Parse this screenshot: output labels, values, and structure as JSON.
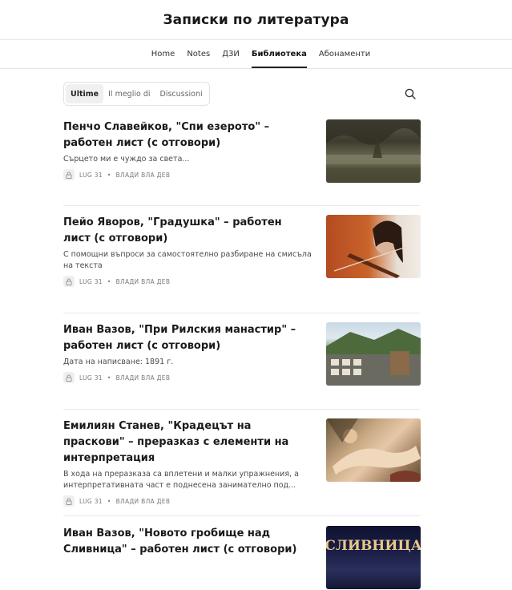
{
  "site": {
    "title": "Записки по литература"
  },
  "nav": {
    "items": [
      {
        "label": "Home"
      },
      {
        "label": "Notes"
      },
      {
        "label": "ДЗИ"
      },
      {
        "label": "Библиотека",
        "active": true
      },
      {
        "label": "Абонаменти"
      }
    ]
  },
  "filters": {
    "tabs": [
      {
        "label": "Ultime",
        "active": true
      },
      {
        "label": "Il meglio di"
      },
      {
        "label": "Discussioni"
      }
    ]
  },
  "posts": [
    {
      "title": "Пенчо Славейков, \"Спи езерото\" – работен лист (с отговори)",
      "subtitle": "Сърцето ми е чуждо за света...",
      "date": "LUG 31",
      "author": "ВЛАДИ ВЛА ДЕВ"
    },
    {
      "title": "Пейо Яворов, \"Градушка\" – работен лист (с отговори)",
      "subtitle": "С помощни въпроси за самостоятелно разбиране на смисъла на текста",
      "date": "LUG 31",
      "author": "ВЛАДИ ВЛА ДЕВ"
    },
    {
      "title": "Иван Вазов, \"При Рилския манастир\" – работен лист (с отговори)",
      "subtitle": "Дата на написване: 1891 г.",
      "date": "LUG 31",
      "author": "ВЛАДИ ВЛА ДЕВ"
    },
    {
      "title": "Емилиян Станев, \"Крадецът на праскови\" – преразказ с елементи на интерпретация",
      "subtitle": "В хода на преразказа са вплетени и малки упражнения, а интерпретативната част е поднесена занимателно под...",
      "date": "LUG 31",
      "author": "ВЛАДИ ВЛА ДЕВ"
    },
    {
      "title": "Иван Вазов, \"Новото гробище над Сливница\" – работен лист (с отговори)",
      "thumb_text": "СЛИВНИЦА"
    }
  ],
  "colors": {
    "accent": "#222222",
    "meta": "#7a7a7a",
    "divider": "#e8e8e8"
  }
}
